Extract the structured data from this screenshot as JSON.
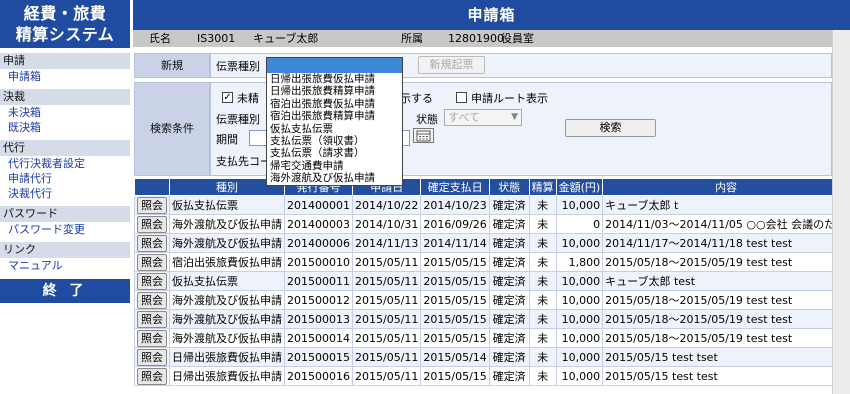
{
  "sidebar": {
    "app_title_line1": "経費・旅費",
    "app_title_line2": "精算システム",
    "sections": [
      {
        "head": "申請",
        "links": [
          "申請箱"
        ]
      },
      {
        "head": "決裁",
        "links": [
          "未決箱",
          "既決箱"
        ]
      },
      {
        "head": "代行",
        "links": [
          "代行決裁者設定",
          "申請代行",
          "決裁代行"
        ]
      },
      {
        "head": "パスワード",
        "links": [
          "パスワード変更"
        ]
      },
      {
        "head": "リンク",
        "links": [
          "マニュアル"
        ]
      }
    ],
    "end_label": "終 了"
  },
  "header": {
    "title": "申請箱",
    "name_label": "氏名",
    "user_id": "IS3001",
    "user_name": "キューブ太郎",
    "dept_label": "所属",
    "dept_code": "12801900",
    "dept_name": "役員室"
  },
  "new_panel": {
    "label": "新規",
    "slip_type_label": "伝票種別",
    "new_button": "新規起票"
  },
  "dropdown": {
    "selected": "",
    "options": [
      "日帰出張旅費仮払申請",
      "日帰出張旅費精算申請",
      "宿泊出張旅費仮払申請",
      "宿泊出張旅費精算申請",
      "仮払支払伝票",
      "支払伝票（領収書）",
      "支払伝票（請求書）",
      "帰宅交通費申請",
      "海外渡航及び仮払申請"
    ]
  },
  "search_panel": {
    "label": "検索条件",
    "unsettled_label": "未精",
    "show_label": "示する",
    "route_label": "申請ルート表示",
    "slip_type_label": "伝票種別",
    "period_label": "期間",
    "status_label": "状態",
    "status_value": "すべて",
    "payee_label": "支払先コー",
    "search_button": "検索"
  },
  "table": {
    "headers": [
      "",
      "種別",
      "発行番号",
      "申請日",
      "確定支払日",
      "状態",
      "精算",
      "金額(円)",
      "内容"
    ],
    "view_label": "照会",
    "rows": [
      [
        "仮払支払伝票",
        "201400001",
        "2014/10/22",
        "2014/10/23",
        "確定済",
        "未",
        "10,000",
        "キューブ太郎 t"
      ],
      [
        "海外渡航及び仮払申請",
        "201400003",
        "2014/10/31",
        "2016/09/26",
        "確定済",
        "未",
        "0",
        "2014/11/03～2014/11/05 ○○会社 会議のため"
      ],
      [
        "海外渡航及び仮払申請",
        "201400006",
        "2014/11/13",
        "2014/11/14",
        "確定済",
        "未",
        "10,000",
        "2014/11/17～2014/11/18 test test"
      ],
      [
        "宿泊出張旅費仮払申請",
        "201500010",
        "2015/05/11",
        "2015/05/15",
        "確定済",
        "未",
        "1,800",
        "2015/05/18～2015/05/19 test test"
      ],
      [
        "仮払支払伝票",
        "201500011",
        "2015/05/11",
        "2015/05/15",
        "確定済",
        "未",
        "10,000",
        "キューブ太郎 test"
      ],
      [
        "海外渡航及び仮払申請",
        "201500012",
        "2015/05/11",
        "2015/05/15",
        "確定済",
        "未",
        "10,000",
        "2015/05/18～2015/05/19 test test"
      ],
      [
        "海外渡航及び仮払申請",
        "201500013",
        "2015/05/11",
        "2015/05/15",
        "確定済",
        "未",
        "10,000",
        "2015/05/18～2015/05/19 test test"
      ],
      [
        "海外渡航及び仮払申請",
        "201500014",
        "2015/05/11",
        "2015/05/15",
        "確定済",
        "未",
        "10,000",
        "2015/05/18～2015/05/19 test test"
      ],
      [
        "日帰出張旅費仮払申請",
        "201500015",
        "2015/05/11",
        "2015/05/14",
        "確定済",
        "未",
        "10,000",
        "2015/05/15 test tset"
      ],
      [
        "日帰出張旅費仮払申請",
        "201500016",
        "2015/05/11",
        "2015/05/15",
        "確定済",
        "未",
        "10,000",
        "2015/05/15 test test"
      ]
    ]
  },
  "icons": {
    "calendar": "calendar-icon",
    "dropdown_arrow": "chevron-down-icon"
  }
}
